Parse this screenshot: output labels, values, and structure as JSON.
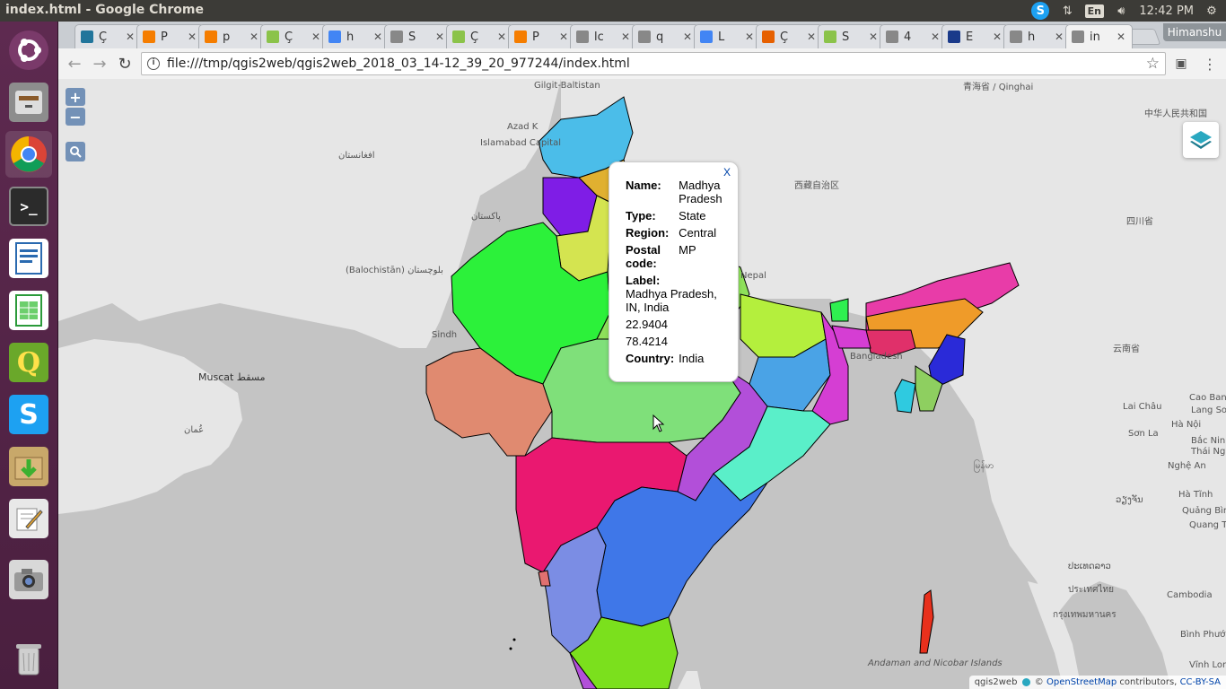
{
  "window": {
    "title": "index.html - Google Chrome"
  },
  "tray": {
    "lang": "En",
    "time": "12:42 PM"
  },
  "launcher": {
    "items": [
      "dash-home",
      "files",
      "chrome",
      "terminal",
      "writer",
      "calc",
      "qgis",
      "skype",
      "archive-manager",
      "text-editor",
      "camera",
      "trash"
    ]
  },
  "tabs": [
    {
      "label": "Ç",
      "favicon": "wordpress-icon",
      "color": "#21759b"
    },
    {
      "label": "P",
      "favicon": "blogger-icon",
      "color": "#f57d00"
    },
    {
      "label": "p",
      "favicon": "blogger-icon",
      "color": "#f57d00"
    },
    {
      "label": "Ç",
      "favicon": "check-icon",
      "color": "#8bc34a"
    },
    {
      "label": "h",
      "favicon": "google-icon",
      "color": "#4285f4"
    },
    {
      "label": "S",
      "favicon": "page-icon",
      "color": "#888888"
    },
    {
      "label": "Ç",
      "favicon": "check-icon",
      "color": "#8bc34a"
    },
    {
      "label": "P",
      "favicon": "blogger-icon",
      "color": "#f57d00"
    },
    {
      "label": "lc",
      "favicon": "page-icon",
      "color": "#888888"
    },
    {
      "label": "q",
      "favicon": "page-icon",
      "color": "#888888"
    },
    {
      "label": "L",
      "favicon": "google-icon",
      "color": "#4285f4"
    },
    {
      "label": "Ç",
      "favicon": "firefox-icon",
      "color": "#e66000"
    },
    {
      "label": "S",
      "favicon": "check-icon",
      "color": "#8bc34a"
    },
    {
      "label": "4",
      "favicon": "page-icon",
      "color": "#888888"
    },
    {
      "label": "E",
      "favicon": "grid-icon",
      "color": "#1a3a8a"
    },
    {
      "label": "h",
      "favicon": "page-icon",
      "color": "#888888"
    },
    {
      "label": "in",
      "favicon": "page-icon",
      "color": "#888888"
    }
  ],
  "profile": "Himanshu",
  "address_bar": {
    "url": "file:///tmp/qgis2web/qgis2web_2018_03_14-12_39_20_977244/index.html"
  },
  "map_controls": {
    "zoom_in": "+",
    "zoom_out": "−"
  },
  "map_labels": [
    "Gilgit-Baltistan",
    "Azad K",
    "Islamabad Capital",
    "Nepal",
    "Bangladesh",
    "Muscat مسقط",
    "Sindh",
    "Andaman and Nicobar Islands",
    "Cambodia",
    "中华人民共和国",
    "青海省 / Qinghai",
    "西藏自治区",
    "四川省",
    "云南省",
    "(Balochistān) بلوچستان",
    "Cao Bang",
    "Lai Châu",
    "Sơn La",
    "Hà Nội",
    "Nghệ An",
    "Hà Tĩnh",
    "Quảng Bình",
    "ປະເທດລາວ",
    "ประเทศไทย",
    "กรุงเทพมหานคร",
    "Bình Phước",
    "Vĩnh Long",
    "မြန်မာ",
    "عُمان",
    "پاکستان",
    "افغانستان",
    "Quang Tri",
    "Lang Son",
    "Bắc Ninh",
    "Thái Nguyên",
    "ວຽງຈັນ"
  ],
  "popup": {
    "close": "X",
    "rows": [
      {
        "key": "Name:",
        "value": "Madhya Pradesh"
      },
      {
        "key": "Type:",
        "value": "State"
      },
      {
        "key": "Region:",
        "value": "Central"
      },
      {
        "key": "Postal code:",
        "value": "MP"
      }
    ],
    "label_key": "Label:",
    "label_value": "Madhya Pradesh, IN, India",
    "lat": "22.9404",
    "lon": "78.4214",
    "country_key": "Country:",
    "country_value": "India"
  },
  "attribution": {
    "qgis": "qgis2web",
    "osm": "OpenStreetMap",
    "contrib": "contributors,",
    "license": "CC-BY-SA",
    "copy": "©"
  },
  "colors": {
    "madhya_pradesh": "#7fe07a",
    "rajasthan": "#2cf13a",
    "gujarat": "#e08a70",
    "maharashtra": "#ea1870",
    "telangana_ap": "#3f77e8",
    "karnataka": "#7b8de4",
    "up": "#8ee05a",
    "bihar": "#b4ef3d",
    "jharkhand": "#4aa3e6",
    "chhattisgarh": "#b24fd9",
    "odisha": "#5aefc9",
    "wb": "#d53ed3",
    "tamil_nadu": "#7be01d",
    "kashmir": "#4bbde9",
    "assam": "#ef9b29",
    "arunachal": "#e83ca8"
  }
}
